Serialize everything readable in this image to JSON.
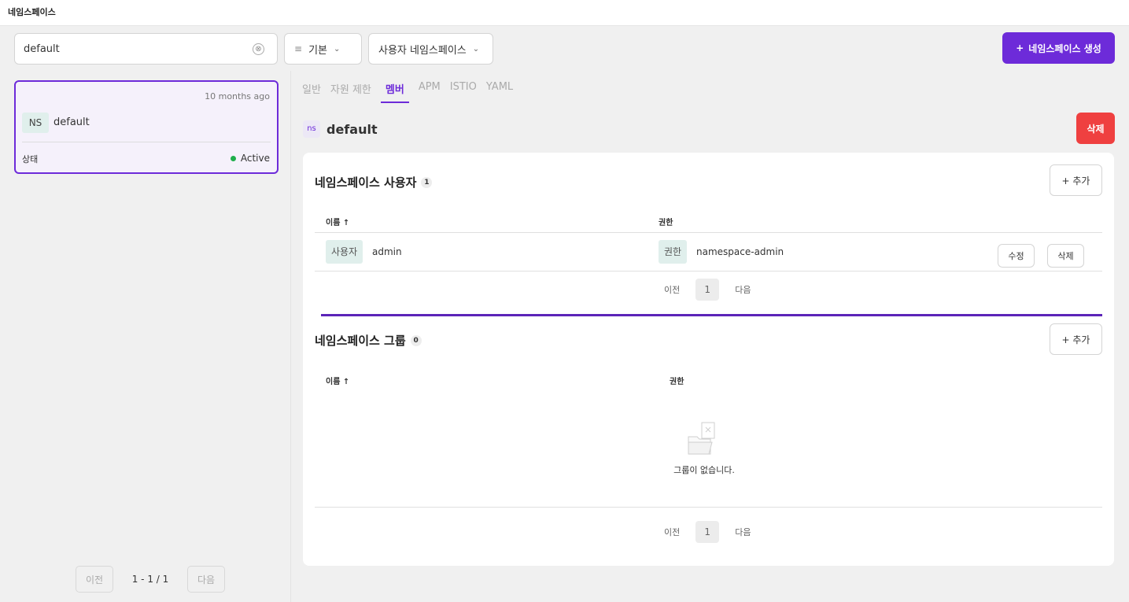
{
  "header": {
    "title": "네임스페이스"
  },
  "toolbar": {
    "search_value": "default",
    "search_placeholder": "",
    "clear_icon": "⊗",
    "filter_icon": "≡",
    "basic_label": "기본",
    "ns_filter_label": "사용자 네임스페이스",
    "chevron": "⌄",
    "create_label": "네임스페이스 생성",
    "create_icon": "+"
  },
  "list": {
    "items": [
      {
        "time": "10 months ago",
        "badge": "NS",
        "name": "default",
        "status_label": "상태",
        "status_value": "Active"
      }
    ],
    "pager": {
      "prev": "이전",
      "info": "1 - 1 / 1",
      "next": "다음"
    }
  },
  "tabs": [
    "일반",
    "자원 제한",
    "멤버",
    "APM",
    "ISTIO",
    "YAML"
  ],
  "active_tab": "멤버",
  "detail": {
    "ns_icon": "ns",
    "title": "default",
    "delete_label": "삭제"
  },
  "users": {
    "title": "네임스페이스 사용자",
    "count": "1",
    "add_label": "+ 추가",
    "col_name": "이름 ↑",
    "col_role": "권한",
    "rows": [
      {
        "type_tag": "사용자",
        "name": "admin",
        "role_tag": "권한",
        "role": "namespace-admin",
        "edit_label": "수정",
        "delete_label": "삭제"
      }
    ],
    "pager": {
      "prev": "이전",
      "page": "1",
      "next": "다음"
    }
  },
  "groups": {
    "title": "네임스페이스 그룹",
    "count": "0",
    "add_label": "+ 추가",
    "col_name": "이름 ↑",
    "col_role": "권한",
    "empty_message": "그룹이 없습니다.",
    "pager": {
      "prev": "이전",
      "page": "1",
      "next": "다음"
    }
  },
  "colors": {
    "accent": "#6d2bd9",
    "danger": "#ef4040",
    "active_dot": "#1fae4b",
    "tag_bg": "#e0efec"
  }
}
